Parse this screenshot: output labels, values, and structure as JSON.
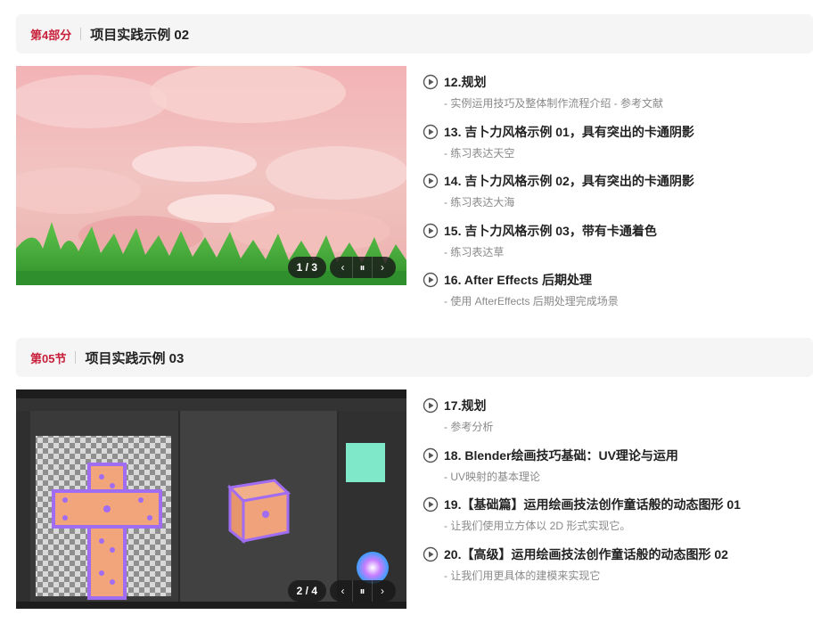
{
  "sections": [
    {
      "part_label": "第4部分",
      "title": "项目实践示例 02",
      "slider": {
        "counter": "1 / 3",
        "prev": "‹",
        "pause": "⏸",
        "next": "›"
      },
      "lessons": [
        {
          "title": "12.规划",
          "subtitle": "- 实例运用技巧及整体制作流程介绍 - 参考文献"
        },
        {
          "title": "13. 吉卜力风格示例 01，具有突出的卡通阴影",
          "subtitle": "- 练习表达天空"
        },
        {
          "title": "14. 吉卜力风格示例 02，具有突出的卡通阴影",
          "subtitle": "- 练习表达大海"
        },
        {
          "title": "15. 吉卜力风格示例 03，带有卡通着色",
          "subtitle": "- 练习表达草"
        },
        {
          "title": "16. After Effects 后期处理",
          "subtitle": "- 使用 AfterEffects 后期处理完成场景"
        }
      ]
    },
    {
      "part_label": "第05节",
      "title": "项目实践示例 03",
      "slider": {
        "counter": "2 / 4",
        "prev": "‹",
        "pause": "⏸",
        "next": "›"
      },
      "lessons": [
        {
          "title": "17.规划",
          "subtitle": "- 参考分析"
        },
        {
          "title": "18. Blender绘画技巧基础：UV理论与运用",
          "subtitle": "- UV映射的基本理论"
        },
        {
          "title": "19.【基础篇】运用绘画技法创作童话般的动态图形 01",
          "subtitle": "- 让我们使用立方体以 2D 形式实现它。"
        },
        {
          "title": "20.【高级】运用绘画技法创作童话般的动态图形 02",
          "subtitle": "- 让我们用更具体的建模来实现它"
        }
      ]
    }
  ],
  "colors": {
    "accent": "#c8203a",
    "header_bg": "#f5f5f5",
    "subtitle": "#8a8a8a"
  },
  "icons": {
    "lesson": "play-circle-icon"
  }
}
